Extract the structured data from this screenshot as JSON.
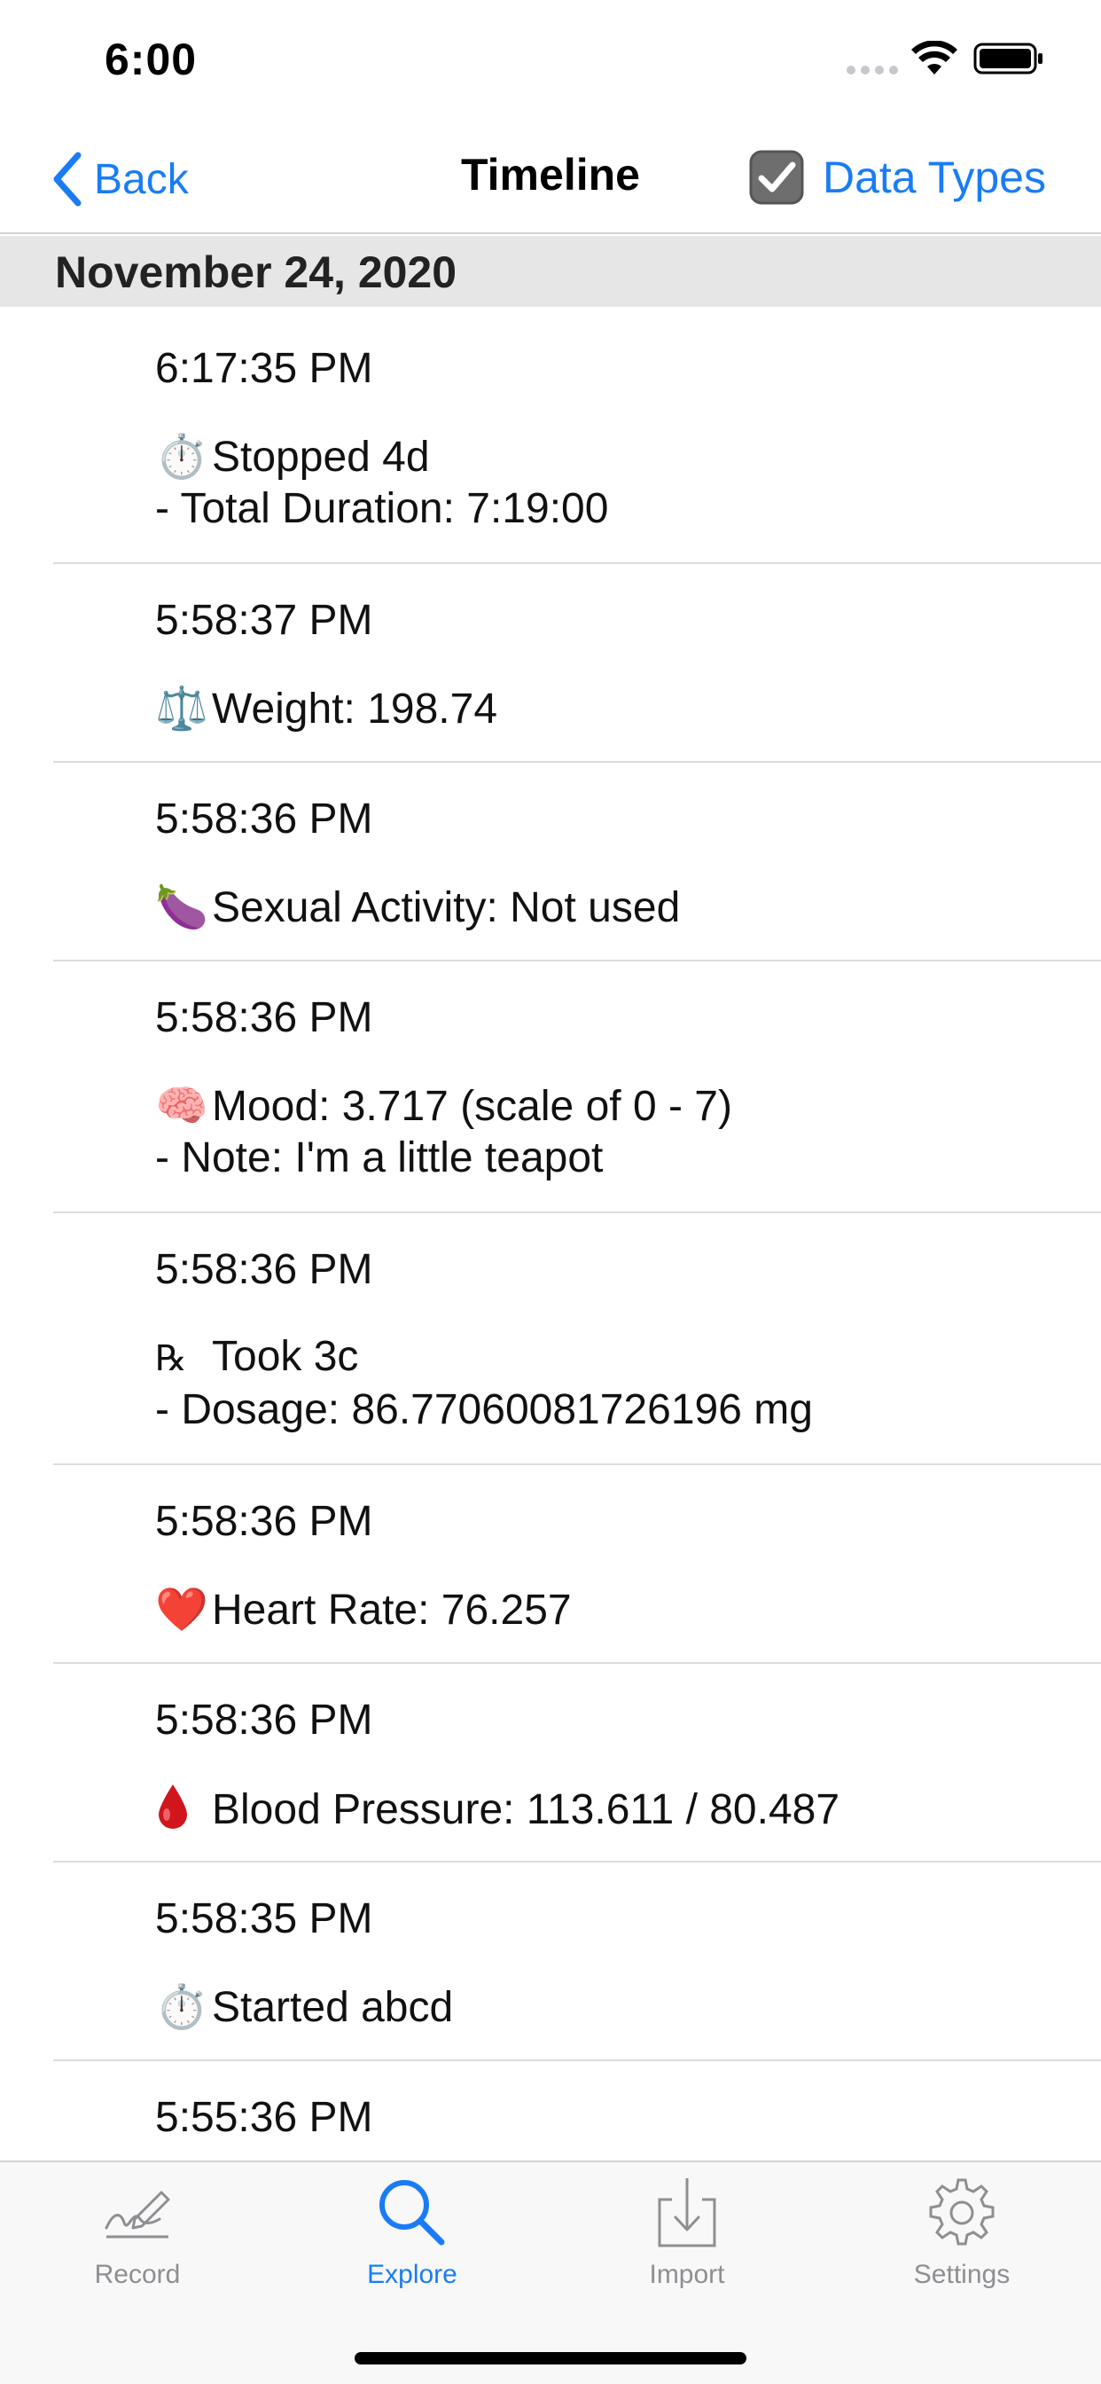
{
  "status_bar": {
    "time": "6:00"
  },
  "nav": {
    "back_label": "Back",
    "title": "Timeline",
    "data_types_label": "Data Types"
  },
  "section": {
    "title": "November 24, 2020"
  },
  "entries": [
    {
      "time": "6:17:35 PM",
      "icon": "stopwatch-icon",
      "emoji": "⏱️",
      "line1": "Stopped 4d",
      "line2": "- Total Duration: 7:19:00"
    },
    {
      "time": "5:58:37 PM",
      "icon": "scale-icon",
      "emoji": "⚖️",
      "line1": "Weight: 198.74"
    },
    {
      "time": "5:58:36 PM",
      "icon": "eggplant-icon",
      "emoji": "🍆",
      "line1": "Sexual Activity: Not used"
    },
    {
      "time": "5:58:36 PM",
      "icon": "brain-icon",
      "emoji": "🧠",
      "line1": "Mood: 3.717 (scale of 0 - 7)",
      "line2": "- Note: I'm a little teapot"
    },
    {
      "time": "5:58:36 PM",
      "icon": "prescription-icon",
      "emoji": "℞",
      "line1": "Took 3c",
      "line2": "- Dosage: 86.77060081726196 mg"
    },
    {
      "time": "5:58:36 PM",
      "icon": "heart-icon",
      "emoji": "❤️",
      "line1": "Heart Rate: 76.257"
    },
    {
      "time": "5:58:36 PM",
      "icon": "blood-drop-icon",
      "emoji": "🩸",
      "line1": "Blood Pressure: 113.611 / 80.487"
    },
    {
      "time": "5:58:35 PM",
      "icon": "stopwatch-icon",
      "emoji": "⏱️",
      "line1": "Started abcd"
    },
    {
      "time": "5:55:36 PM"
    }
  ],
  "tabs": [
    {
      "label": "Record",
      "icon": "signature-pen-icon",
      "active": false
    },
    {
      "label": "Explore",
      "icon": "search-icon",
      "active": true
    },
    {
      "label": "Import",
      "icon": "import-tray-icon",
      "active": false
    },
    {
      "label": "Settings",
      "icon": "gear-icon",
      "active": false
    }
  ],
  "colors": {
    "accent": "#1a7cf5",
    "inactive_tab": "#8e8e93",
    "section_bg": "#e6e6e6"
  }
}
